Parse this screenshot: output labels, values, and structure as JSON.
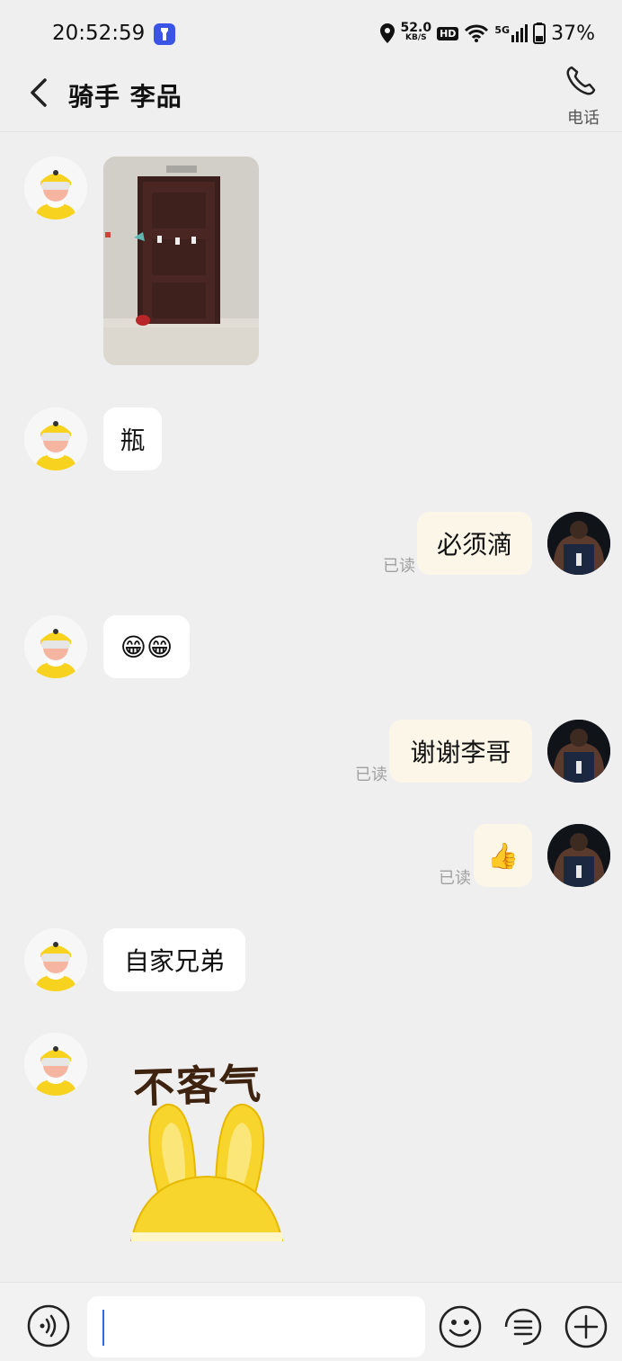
{
  "status_bar": {
    "time": "20:52:59",
    "net_speed_value": "52.0",
    "net_speed_unit": "KB/S",
    "hd": "HD",
    "network": "5G",
    "battery": "37%"
  },
  "nav": {
    "title": "骑手 李品",
    "call_label": "电话"
  },
  "messages": [
    {
      "sender": "rider",
      "type": "image",
      "description": "door-photo"
    },
    {
      "sender": "rider",
      "type": "text",
      "text": "瓶"
    },
    {
      "sender": "me",
      "type": "text",
      "text": "必须滴",
      "read": "已读"
    },
    {
      "sender": "rider",
      "type": "emoji",
      "text": "😁😁"
    },
    {
      "sender": "me",
      "type": "text",
      "text": "谢谢李哥",
      "read": "已读"
    },
    {
      "sender": "me",
      "type": "emoji",
      "text": "👍",
      "read": "已读"
    },
    {
      "sender": "rider",
      "type": "text",
      "text": "自家兄弟"
    },
    {
      "sender": "rider",
      "type": "sticker",
      "text": "不客气"
    }
  ],
  "input": {
    "value": "",
    "placeholder": ""
  },
  "colors": {
    "background": "#efefef",
    "bubble_in": "#ffffff",
    "bubble_out": "#fbf6e8",
    "accent_blue": "#3a55e5",
    "rider_yellow": "#f7d21e"
  }
}
